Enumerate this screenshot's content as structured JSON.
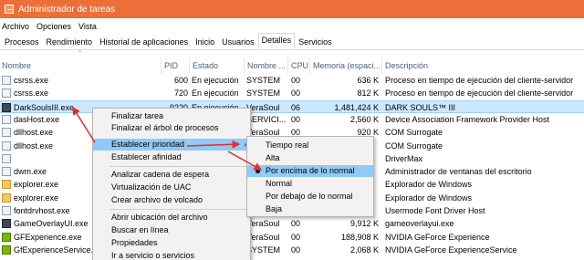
{
  "window": {
    "title": "Administrador de tareas"
  },
  "menus": [
    "Archivo",
    "Opciones",
    "Vista"
  ],
  "tabs": [
    "Procesos",
    "Rendimiento",
    "Historial de aplicaciones",
    "Inicio",
    "Usuarios",
    "Detalles",
    "Servicios"
  ],
  "active_tab": "Detalles",
  "columns": [
    "Nombre",
    "PID",
    "Estado",
    "Nombre ...",
    "CPU",
    "Memoria (espaci...",
    "Descripción"
  ],
  "rows": [
    {
      "name": "csrss.exe",
      "pid": "600",
      "state": "En ejecución",
      "user": "SYSTEM",
      "cpu": "00",
      "mem": "636 K",
      "desc": "Proceso en tiempo de ejecución del cliente-servidor",
      "icon": "process-icon"
    },
    {
      "name": "csrss.exe",
      "pid": "720",
      "state": "En ejecución",
      "user": "SYSTEM",
      "cpu": "00",
      "mem": "812 K",
      "desc": "Proceso en tiempo de ejecución del cliente-servidor",
      "icon": "process-icon"
    },
    {
      "name": "DarkSoulsIII.exe",
      "pid": "9220",
      "state": "En ejecución",
      "user": "VeraSoul",
      "cpu": "06",
      "mem": "1,481,424 K",
      "desc": "DARK SOULS™ III",
      "icon": "game-icon",
      "selected": true
    },
    {
      "name": "dasHost.exe",
      "pid": "",
      "state": "",
      "user": "SERVICI...",
      "cpu": "00",
      "mem": "2,560 K",
      "desc": "Device Association Framework Provider Host",
      "icon": "process-icon"
    },
    {
      "name": "dllhost.exe",
      "pid": "",
      "state": "",
      "user": "VeraSoul",
      "cpu": "00",
      "mem": "920 K",
      "desc": "COM Surrogate",
      "icon": "process-icon"
    },
    {
      "name": "dllhost.exe",
      "pid": "",
      "state": "",
      "user": "",
      "cpu": "",
      "mem": "",
      "desc": "COM Surrogate",
      "icon": "process-icon"
    },
    {
      "name": "",
      "pid": "",
      "state": "",
      "user": "",
      "cpu": "",
      "mem": "",
      "desc": "DriverMax",
      "icon": "process-icon"
    },
    {
      "name": "dwm.exe",
      "pid": "",
      "state": "",
      "user": "",
      "cpu": "",
      "mem": "",
      "desc": "Administrador de ventanas del escritorio",
      "icon": "process-icon"
    },
    {
      "name": "explorer.exe",
      "pid": "",
      "state": "",
      "user": "",
      "cpu": "",
      "mem": "",
      "desc": "Explorador de Windows",
      "icon": "folder-icon"
    },
    {
      "name": "explorer.exe",
      "pid": "",
      "state": "",
      "user": "",
      "cpu": "",
      "mem": "",
      "desc": "Explorador de Windows",
      "icon": "folder-icon"
    },
    {
      "name": "fontdrvhost.exe",
      "pid": "",
      "state": "",
      "user": "",
      "cpu": "",
      "mem": "",
      "desc": "Usermode Font Driver Host",
      "icon": "process-icon"
    },
    {
      "name": "GameOverlayUI.exe",
      "pid": "",
      "state": "",
      "user": "VeraSoul",
      "cpu": "00",
      "mem": "9,912 K",
      "desc": "gameoverlayui.exe",
      "icon": "steam-icon"
    },
    {
      "name": "GFExperience.exe",
      "pid": "",
      "state": "",
      "user": "VeraSoul",
      "cpu": "00",
      "mem": "188,908 K",
      "desc": "NVIDIA GeForce Experience",
      "icon": "nvidia-icon"
    },
    {
      "name": "GfExperienceService.exe",
      "pid": "",
      "state": "",
      "user": "SYSTEM",
      "cpu": "00",
      "mem": "2,068 K",
      "desc": "NVIDIA GeForce ExperienceService",
      "icon": "nvidia-icon"
    }
  ],
  "context_menu": {
    "items": [
      "Finalizar tarea",
      "Finalizar el árbol de procesos",
      "Establecer prioridad",
      "Establecer afinidad",
      "Analizar cadena de espera",
      "Virtualización de UAC",
      "Crear archivo de volcado",
      "Abrir ubicación del archivo",
      "Buscar en línea",
      "Propiedades",
      "Ir a servicio o servicios"
    ],
    "highlighted": "Establecer prioridad",
    "submenu_arrow": "›"
  },
  "priority_submenu": {
    "items": [
      "Tiempo real",
      "Alta",
      "Por encima de lo normal",
      "Normal",
      "Por debajo de lo normal",
      "Baja"
    ],
    "selected": "Por encima de lo normal",
    "bullet": "•"
  },
  "colors": {
    "titlebar": "#ec6f3a",
    "selection": "#cce8ff",
    "menu_highlight": "#91c9f7",
    "annotation_arrow": "#e03030"
  }
}
